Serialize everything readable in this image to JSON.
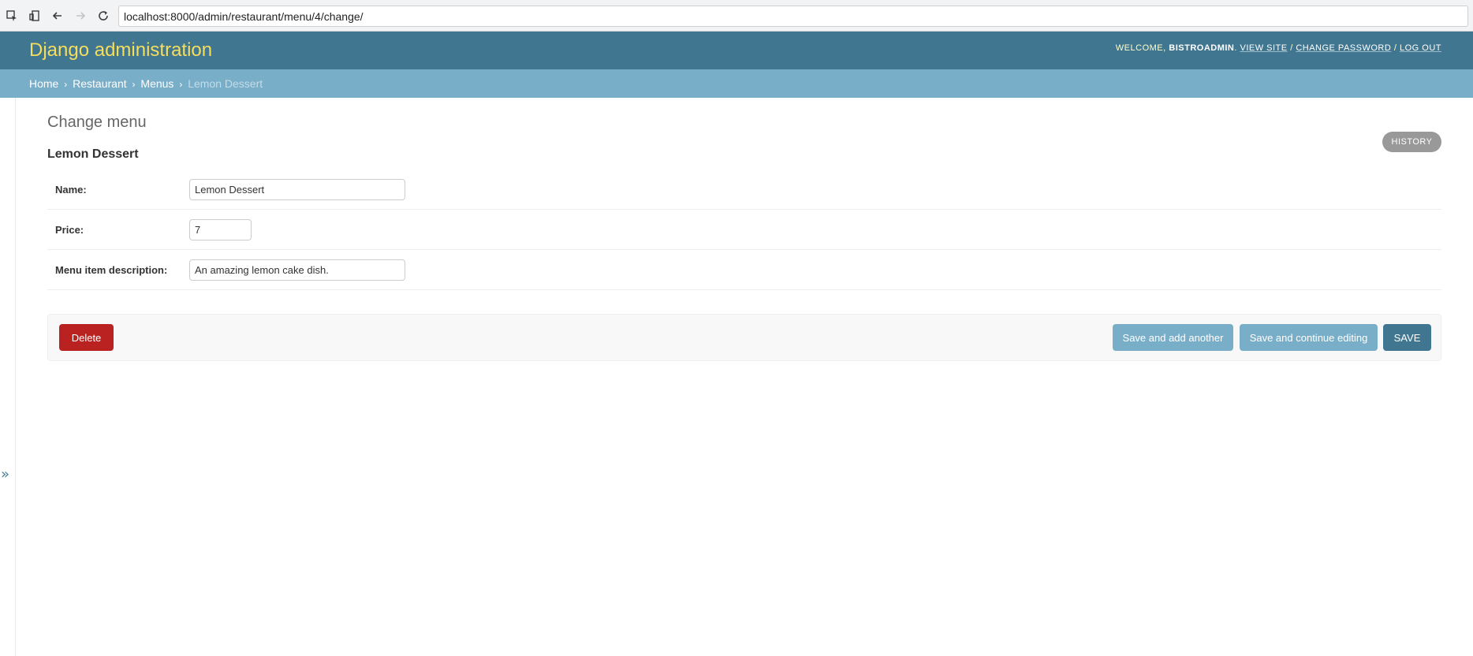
{
  "browser": {
    "url": "localhost:8000/admin/restaurant/menu/4/change/"
  },
  "header": {
    "branding": "Django administration",
    "welcome": "Welcome,",
    "username": "bistroadmin",
    "view_site": "View site",
    "change_password": "Change password",
    "log_out": "Log out"
  },
  "breadcrumbs": [
    {
      "label": "Home"
    },
    {
      "label": "Restaurant"
    },
    {
      "label": "Menus"
    },
    {
      "label": "Lemon Dessert"
    }
  ],
  "content": {
    "page_title": "Change menu",
    "object_title": "Lemon Dessert",
    "history_label": "History",
    "fields": [
      {
        "label": "Name:",
        "value": "Lemon Dessert"
      },
      {
        "label": "Price:",
        "value": "7"
      },
      {
        "label": "Menu item description:",
        "value": "An amazing lemon cake dish."
      }
    ]
  },
  "submit_row": {
    "delete_label": "Delete",
    "save_add_label": "Save and add another",
    "save_continue_label": "Save and continue editing",
    "save_label": "SAVE"
  },
  "colors": {
    "header_bg": "#417690",
    "branding": "#f5dd5d",
    "breadcrumb_bg": "#79aec8",
    "delete_bg": "#ba2121",
    "save_bg": "#417690"
  }
}
